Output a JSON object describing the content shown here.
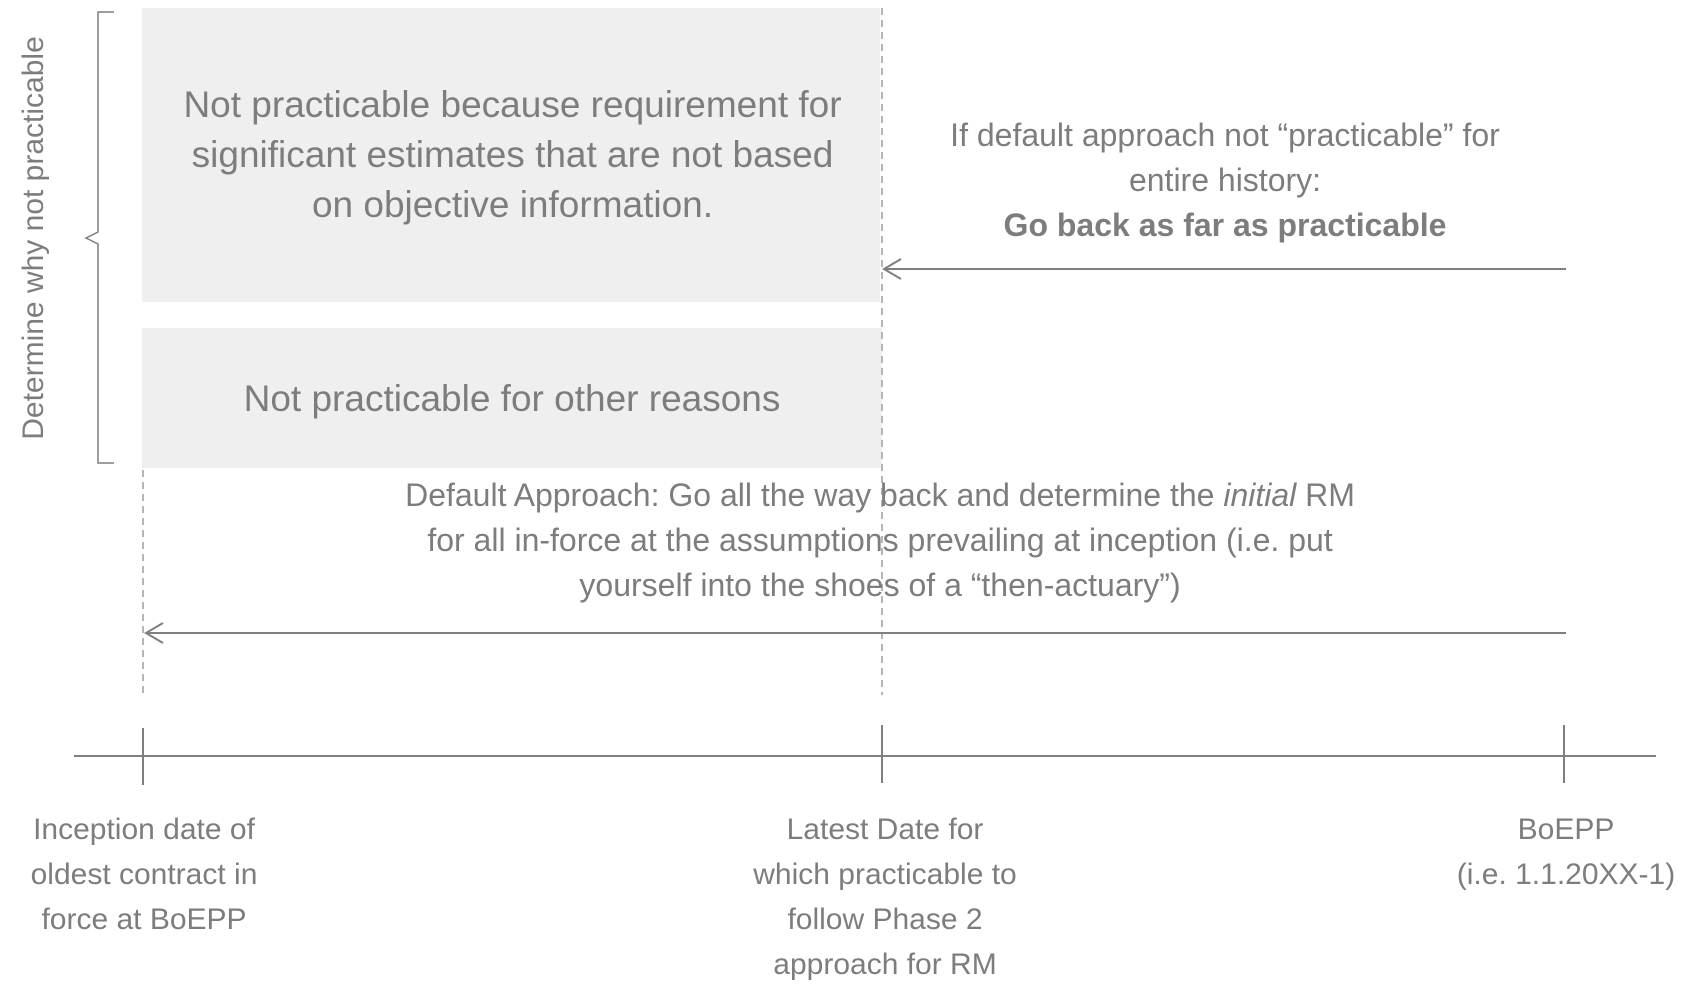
{
  "side_label": "Determine why not practicable",
  "box_estimates": "Not practicable because requirement for significant estimates that are not based on objective information.",
  "box_other": "Not practicable for other reasons",
  "partial_note": {
    "line1": "If default approach not “practicable” for",
    "line2": "entire history:",
    "line3": "Go back as far as practicable"
  },
  "default_note": {
    "prefix": "Default Approach: Go all the way back and determine the ",
    "italic": "initial",
    "suffix": " RM",
    "line2": "for all in-force at the assumptions prevailing at inception (i.e. put",
    "line3": "yourself into the shoes of a “then-actuary”)"
  },
  "timeline_points": {
    "inception": [
      "Inception date of",
      "oldest contract in",
      "force at BoEPP"
    ],
    "latest": [
      "Latest Date for",
      "which practicable to",
      "follow Phase 2",
      "approach for RM"
    ],
    "boepp": [
      "BoEPP",
      "(i.e. 1.1.20XX-1)"
    ]
  },
  "colors": {
    "box": "#efefef",
    "text": "#7d7d7d",
    "line": "#7f7f7f",
    "dashed": "#b5b5b5"
  }
}
